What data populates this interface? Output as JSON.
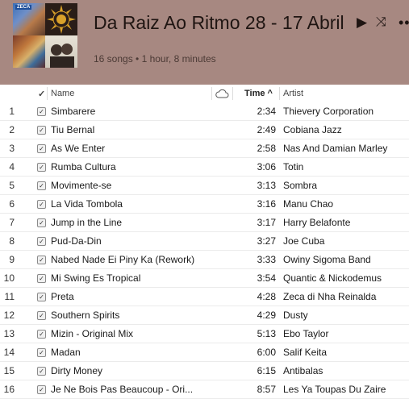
{
  "playlist": {
    "title": "Da Raiz Ao Ritmo 28 - 17 Abril",
    "summary": "16 songs • 1 hour, 8 minutes",
    "artwork_label": "ZECA"
  },
  "controls": {
    "play": "▶",
    "shuffle": "⤨",
    "more": "•••"
  },
  "columns": {
    "check": "✓",
    "name": "Name",
    "time": "Time ^",
    "artist": "Artist"
  },
  "tracks": [
    {
      "num": "1",
      "name": "Simbarere",
      "time": "2:34",
      "artist": "Thievery Corporation"
    },
    {
      "num": "2",
      "name": "Tiu Bernal",
      "time": "2:49",
      "artist": "Cobiana Jazz"
    },
    {
      "num": "3",
      "name": "As We Enter",
      "time": "2:58",
      "artist": "Nas And Damian Marley"
    },
    {
      "num": "4",
      "name": "Rumba Cultura",
      "time": "3:06",
      "artist": "Totin"
    },
    {
      "num": "5",
      "name": "Movimente-se",
      "time": "3:13",
      "artist": "Sombra"
    },
    {
      "num": "6",
      "name": "La Vida Tombola",
      "time": "3:16",
      "artist": "Manu Chao"
    },
    {
      "num": "7",
      "name": "Jump in the Line",
      "time": "3:17",
      "artist": "Harry Belafonte"
    },
    {
      "num": "8",
      "name": "Pud-Da-Din",
      "time": "3:27",
      "artist": "Joe Cuba"
    },
    {
      "num": "9",
      "name": "Nabed Nade Ei Piny Ka (Rework)",
      "time": "3:33",
      "artist": "Owiny Sigoma Band"
    },
    {
      "num": "10",
      "name": "Mi Swing Es Tropical",
      "time": "3:54",
      "artist": "Quantic & Nickodemus"
    },
    {
      "num": "11",
      "name": "Preta",
      "time": "4:28",
      "artist": "Zeca di Nha Reinalda"
    },
    {
      "num": "12",
      "name": "Southern Spirits",
      "time": "4:29",
      "artist": "Dusty"
    },
    {
      "num": "13",
      "name": "Mizin - Original Mix",
      "time": "5:13",
      "artist": "Ebo Taylor"
    },
    {
      "num": "14",
      "name": "Madan",
      "time": "6:00",
      "artist": "Salif Keita"
    },
    {
      "num": "15",
      "name": "Dirty Money",
      "time": "6:15",
      "artist": "Antibalas"
    },
    {
      "num": "16",
      "name": "Je Ne Bois Pas Beaucoup - Ori...",
      "time": "8:57",
      "artist": "Les Ya Toupas Du Zaire"
    }
  ],
  "colors": {
    "header_bg": "#a78881",
    "row_divider": "#ebebeb"
  }
}
